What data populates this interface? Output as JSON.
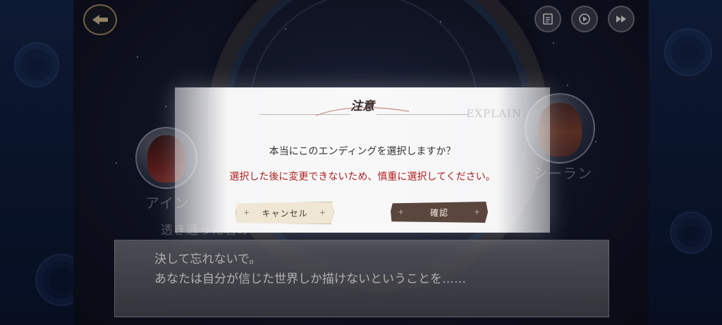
{
  "icons": {
    "back": "back-arrow-icon",
    "log": "log-icon",
    "auto": "auto-play-icon",
    "skip": "skip-icon"
  },
  "background": {
    "left_name": "アイン",
    "right_name": "シーラン",
    "sub_text": "透き通った君の"
  },
  "dialog": {
    "line1": "決して忘れないで。",
    "line2": "あなたは自分が信じた世界しか描けないということを……"
  },
  "modal": {
    "title": "注意",
    "watermark": "EXPLAIN",
    "question": "本当にこのエンディングを選択しますか？",
    "warning": "選択した後に変更できないため、慎重に選択してください。",
    "cancel_label": "キャンセル",
    "confirm_label": "確認"
  },
  "colors": {
    "warning_text": "#b02020",
    "confirm_button": "#5a463c",
    "cancel_button": "#efe6d4"
  }
}
